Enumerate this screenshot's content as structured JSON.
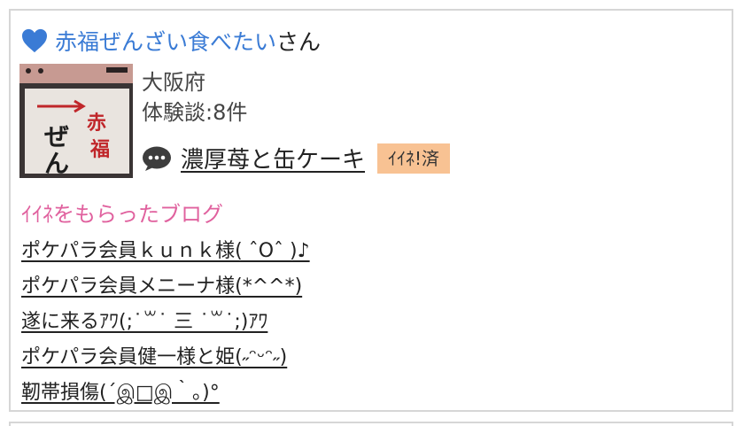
{
  "user": {
    "name": "赤福ぜんざい食べたい",
    "honorific": "さん",
    "prefecture": "大阪府",
    "review_count": "体験談:8件"
  },
  "thumbnail": {
    "sign_chars": [
      "赤",
      "福",
      "ぜ",
      "ん"
    ]
  },
  "review": {
    "title": "濃厚苺と缶ケーキ",
    "badge": "ｲｲﾈ!済"
  },
  "liked_section": {
    "title": "ｲｲﾈをもらったブログ",
    "items": [
      "ポケパラ会員ｋｕｎｋ様( ˆOˆ )♪",
      "ポケパラ会員メニーナ様(*^^*)",
      "遂に来るｱﾜ(;˙꒳˙ 三 ˙꒳˙;)ｱﾜ",
      "ポケパラ会員健一様と姫(˶ᵔᵕᵔ˶)",
      "靭帯損傷(´இ□இ｀｡)°"
    ]
  },
  "colors": {
    "link_blue": "#3a7bd5",
    "pink": "#e0619e",
    "badge_bg": "#f8c293"
  }
}
